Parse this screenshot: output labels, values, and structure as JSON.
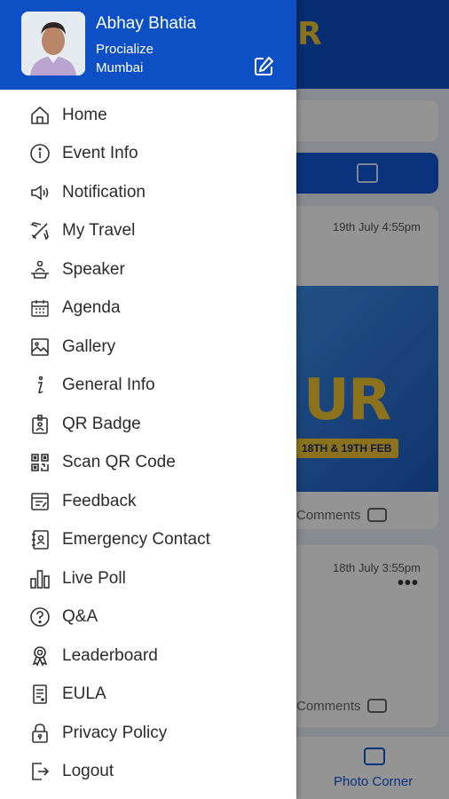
{
  "profile": {
    "name": "Abhay Bhatia",
    "company": "Procialize",
    "city": "Mumbai"
  },
  "menu": {
    "items": [
      {
        "label": "Home",
        "icon": "home-icon"
      },
      {
        "label": "Event Info",
        "icon": "info-icon"
      },
      {
        "label": "Notification",
        "icon": "speaker-icon"
      },
      {
        "label": "My Travel",
        "icon": "airplane-icon"
      },
      {
        "label": "Speaker",
        "icon": "podium-icon"
      },
      {
        "label": "Agenda",
        "icon": "calendar-icon"
      },
      {
        "label": "Gallery",
        "icon": "image-icon"
      },
      {
        "label": "General Info",
        "icon": "info-italic-icon"
      },
      {
        "label": "QR Badge",
        "icon": "badge-icon"
      },
      {
        "label": "Scan QR Code",
        "icon": "qr-icon"
      },
      {
        "label": "Feedback",
        "icon": "feedback-icon"
      },
      {
        "label": "Emergency Contact",
        "icon": "contact-book-icon"
      },
      {
        "label": "Live Poll",
        "icon": "bar-chart-icon"
      },
      {
        "label": "Q&A",
        "icon": "question-icon"
      },
      {
        "label": "Leaderboard",
        "icon": "trophy-icon"
      },
      {
        "label": "EULA",
        "icon": "document-icon"
      },
      {
        "label": "Privacy Policy",
        "icon": "lock-icon"
      },
      {
        "label": "Logout",
        "icon": "logout-icon"
      }
    ]
  },
  "background": {
    "post1_time": "19th July 4:55pm",
    "post2_time": "18th July 3:55pm",
    "banner_date": "18TH & 19TH FEB",
    "banner_text": "UR",
    "comments_label": "Comments",
    "bottom_nav_label": "Photo Corner"
  },
  "colors": {
    "header_blue": "#0d4fc4",
    "text": "#2b2b2b"
  }
}
